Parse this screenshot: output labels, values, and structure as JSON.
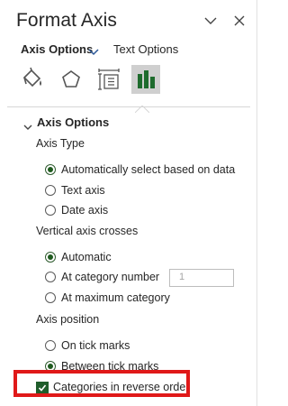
{
  "pane": {
    "title": "Format Axis",
    "collapse_icon": "chevron-down-icon",
    "close_icon": "close-icon"
  },
  "tabs": {
    "axis_options": "Axis Options",
    "text_options": "Text Options"
  },
  "icon_tabs": [
    {
      "name": "fill-line",
      "icon": "paint-bucket-icon",
      "selected": false
    },
    {
      "name": "effects",
      "icon": "pentagon-icon",
      "selected": false
    },
    {
      "name": "size-properties",
      "icon": "size-properties-icon",
      "selected": false
    },
    {
      "name": "axis-options",
      "icon": "bar-chart-icon",
      "selected": true
    }
  ],
  "section": {
    "title": "Axis Options",
    "axis_type": {
      "label": "Axis Type",
      "options": [
        "Automatically select based on data",
        "Text axis",
        "Date axis"
      ],
      "selected": "Automatically select based on data"
    },
    "vertical_crosses": {
      "label": "Vertical axis crosses",
      "options": [
        "Automatic",
        "At category number",
        "At maximum category"
      ],
      "selected": "Automatic",
      "category_number_value": "1"
    },
    "axis_position": {
      "label": "Axis position",
      "options": [
        "On tick marks",
        "Between tick marks"
      ],
      "selected": "Between tick marks"
    },
    "reverse_order": {
      "label": "Categories in reverse order",
      "checked": true
    }
  },
  "colors": {
    "accent": "#1e5a1e",
    "highlight": "#e01919",
    "selected_tab_bg": "#cfcfcf"
  }
}
